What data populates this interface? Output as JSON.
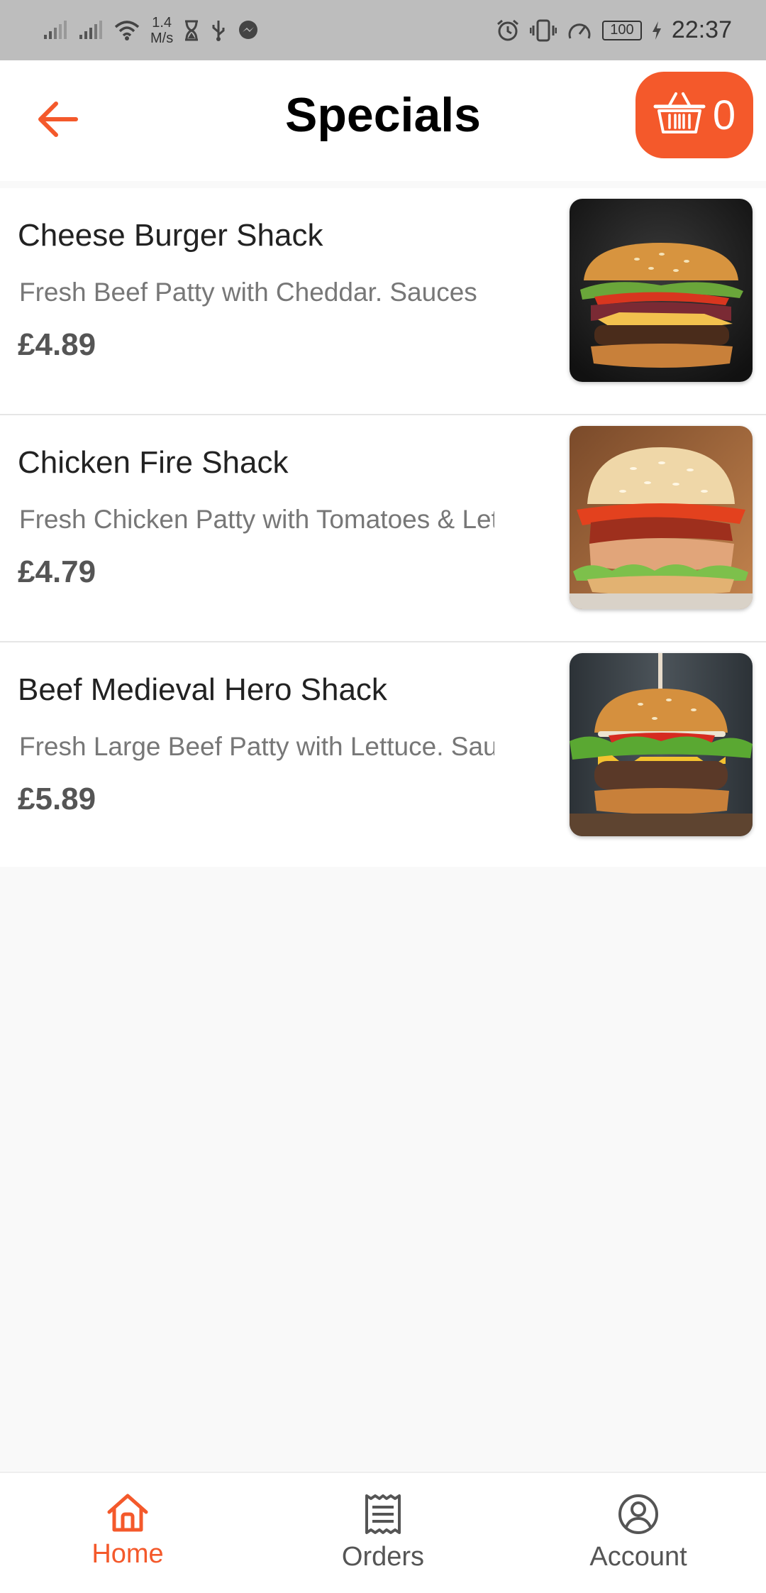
{
  "status_bar": {
    "speed_value": "1.4",
    "speed_unit": "M/s",
    "battery": "100",
    "time": "22:37"
  },
  "header": {
    "title": "Specials",
    "cart_count": "0"
  },
  "colors": {
    "accent": "#f4592b",
    "text_dark": "#222222",
    "text_muted": "#777777",
    "background": "#f9f9f9"
  },
  "items": [
    {
      "name": "Cheese Burger Shack",
      "description": "Fresh Beef Patty with Cheddar. Sauces",
      "price": "£4.89",
      "image": "burger-dark-background"
    },
    {
      "name": "Chicken Fire Shack",
      "description": "Fresh Chicken Patty with Tomatoes & Lettuce",
      "price": "£4.79",
      "image": "chicken-burger-wood-background"
    },
    {
      "name": "Beef Medieval Hero Shack",
      "description": "Fresh Large Beef Patty with Lettuce. Sauces",
      "price": "£5.89",
      "image": "beef-burger-skewer"
    }
  ],
  "bottom_nav": [
    {
      "label": "Home",
      "icon": "home-icon",
      "active": true
    },
    {
      "label": "Orders",
      "icon": "receipt-icon",
      "active": false
    },
    {
      "label": "Account",
      "icon": "account-icon",
      "active": false
    }
  ]
}
